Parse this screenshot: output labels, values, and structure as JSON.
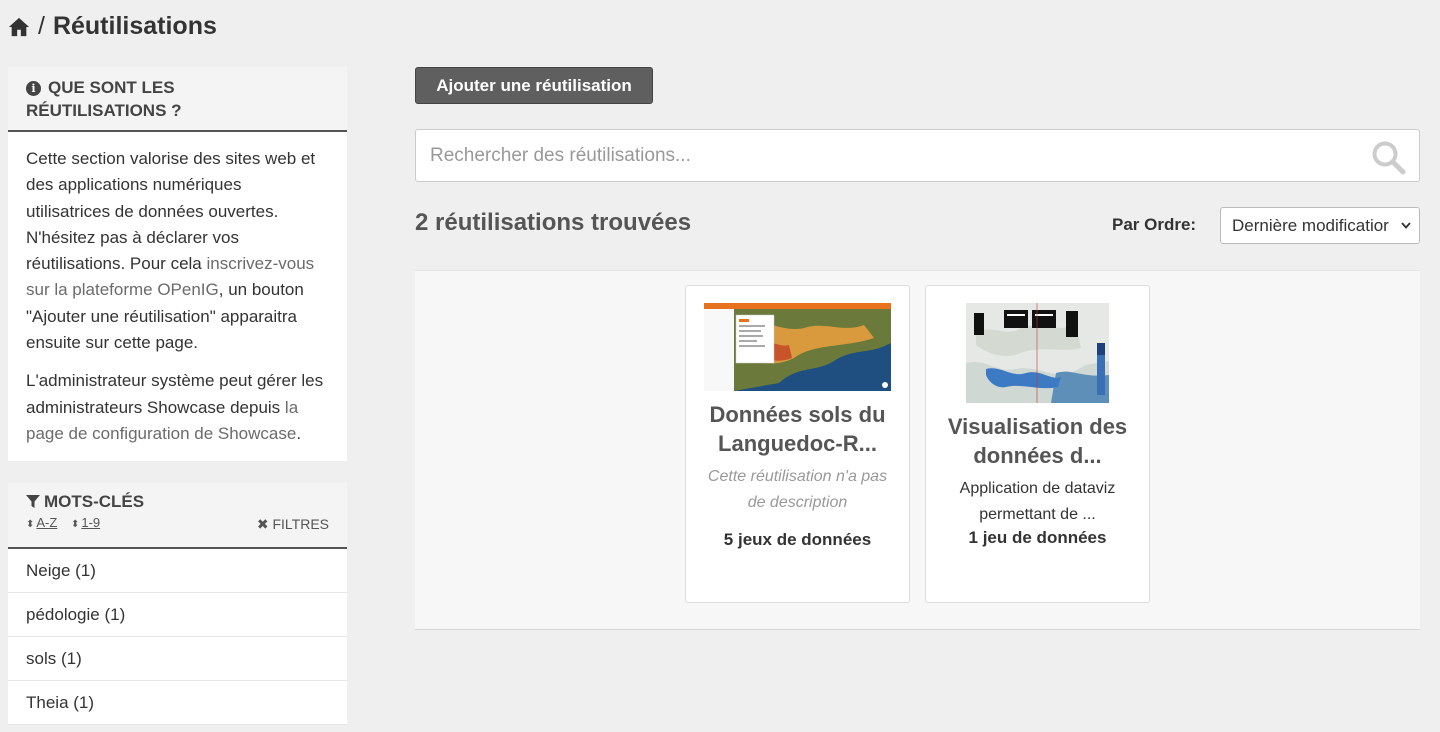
{
  "breadcrumb": {
    "separator": "/",
    "title": "Réutilisations"
  },
  "info": {
    "title_line1": "QUE SONT LES",
    "title_line2": "RÉUTILISATIONS ?",
    "p1_before": "Cette section valorise des sites web et des applications numériques utilisatrices de données ouvertes. N'hésitez pas à déclarer vos réutilisations. Pour cela ",
    "p1_link": "inscrivez-vous sur la plateforme OPenIG",
    "p1_after": ", un bouton \"Ajouter une réutilisation\" apparaitra ensuite sur cette page.",
    "p2_before": "L'administrateur système peut gérer les administrateurs Showcase depuis ",
    "p2_link": "la page de configuration de Showcase",
    "p2_after": "."
  },
  "keywords": {
    "title": "MOTS-CLÉS",
    "sort_az": "A-Z",
    "sort_19": "1-9",
    "filter_label": "FILTRES",
    "items": [
      {
        "label": "Neige (1)"
      },
      {
        "label": "pédologie (1)"
      },
      {
        "label": "sols (1)"
      },
      {
        "label": "Theia (1)"
      }
    ]
  },
  "main": {
    "add_button": "Ajouter une réutilisation",
    "search_placeholder": "Rechercher des réutilisations...",
    "count": "2 réutilisations trouvées",
    "order_label": "Par Ordre:",
    "order_value": "Dernière modificatior"
  },
  "cards": [
    {
      "title": "Données sols du Languedoc-R...",
      "description": "Cette réutilisation n'a pas de description",
      "datasets": "5 jeux de données"
    },
    {
      "title": "Visualisation des données d...",
      "description": "Application de dataviz permettant de ...",
      "datasets": "1 jeu de données"
    }
  ],
  "colors": {
    "accent_button": "#5f5f5f",
    "background": "#efefef",
    "link": "#6b6b6b"
  }
}
